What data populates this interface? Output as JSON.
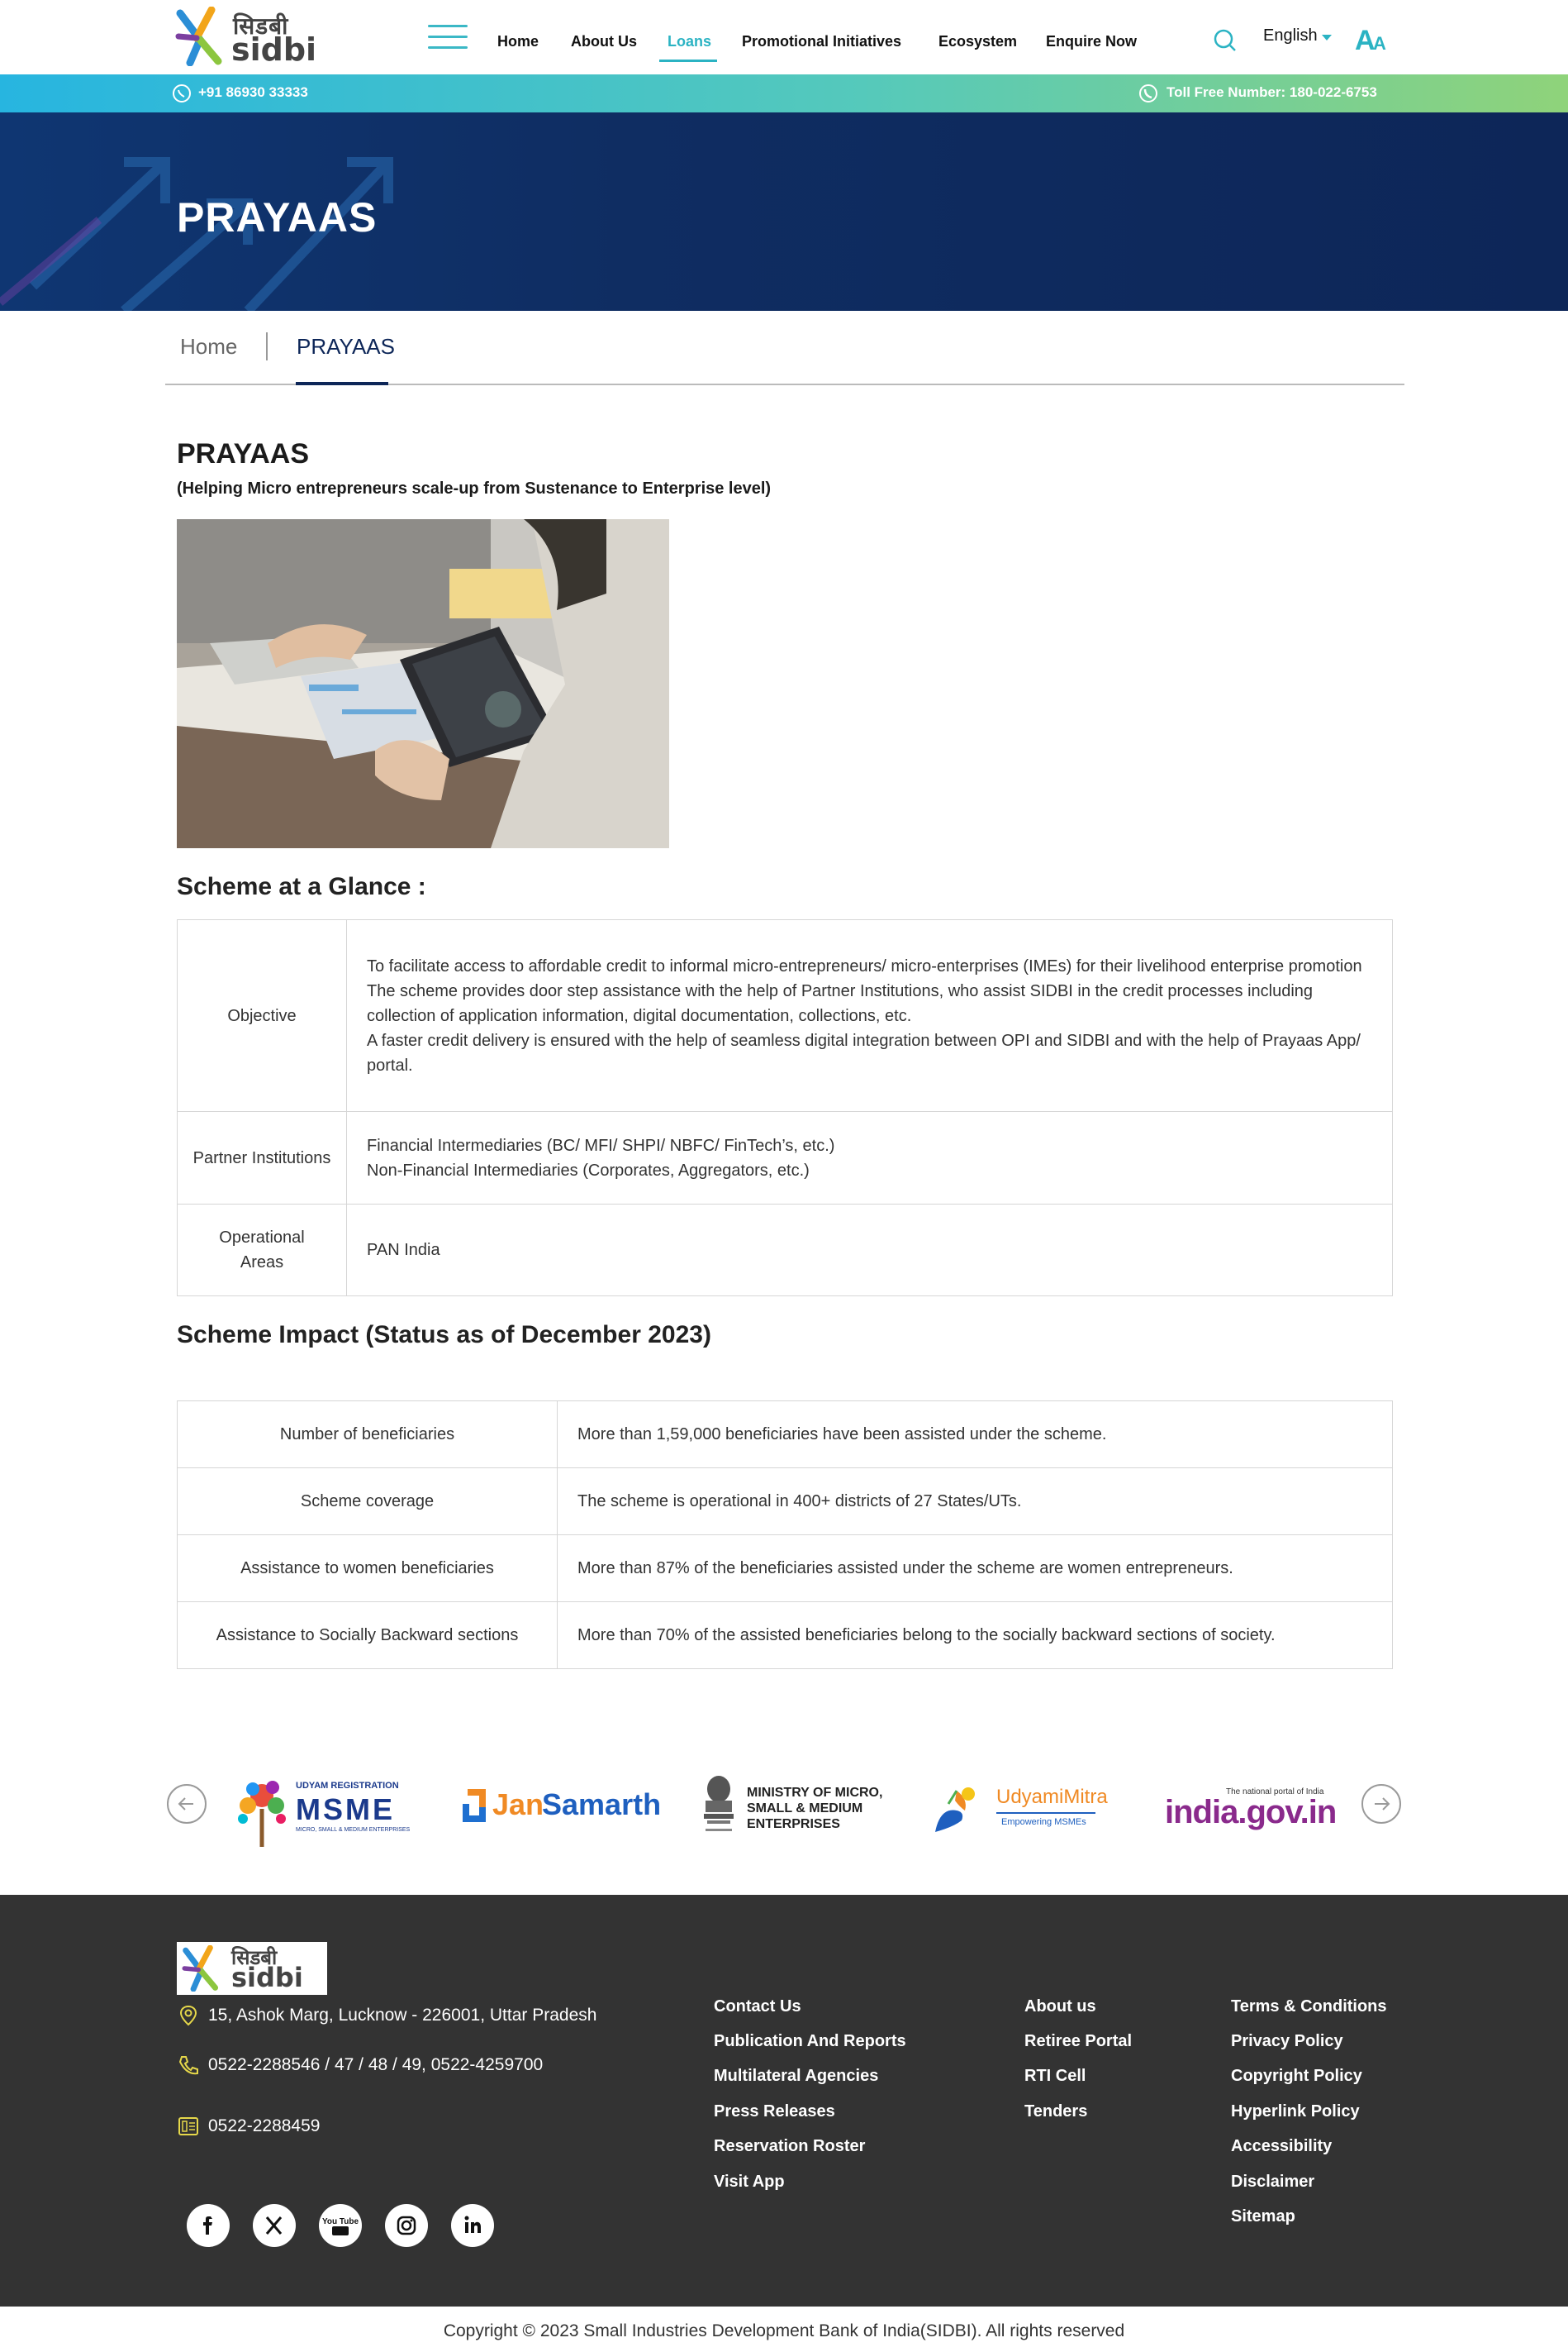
{
  "header": {
    "logo_hindi": "सिडबी",
    "logo_english": "sidbi",
    "nav": [
      "Home",
      "About Us",
      "Loans",
      "Promotional Initiatives",
      "Ecosystem",
      "Enquire Now"
    ],
    "active_nav": "Loans",
    "language": "English",
    "accent_color": "#2bb3c3"
  },
  "strip": {
    "phone": "+91 86930 33333",
    "toll_free": "Toll Free Number: 180-022-6753"
  },
  "banner": {
    "title": "PRAYAAS"
  },
  "breadcrumb": [
    "Home",
    "PRAYAAS"
  ],
  "page": {
    "title": "PRAYAAS",
    "subtitle": "(Helping Micro entrepreneurs scale-up from Sustenance to Enterprise level)"
  },
  "glance": {
    "heading": "Scheme at a Glance :",
    "rows": [
      {
        "label": "Objective",
        "lines": [
          "To facilitate access to affordable credit to informal micro-entrepreneurs/ micro-enterprises (IMEs) for their livelihood enterprise promotion",
          "The scheme provides door step assistance with the help of Partner Institutions, who assist SIDBI in the credit processes including collection of application information, digital documentation, collections, etc.",
          "A faster credit delivery is ensured with the help of seamless digital integration between OPI and SIDBI and with the help of Prayaas App/ portal."
        ]
      },
      {
        "label": "Partner Institutions",
        "lines": [
          "Financial Intermediaries (BC/ MFI/ SHPI/ NBFC/ FinTech’s, etc.)",
          "Non-Financial Intermediaries (Corporates, Aggregators, etc.)"
        ]
      },
      {
        "label": "Operational Areas",
        "lines": [
          "PAN India"
        ]
      }
    ]
  },
  "impact": {
    "heading": "Scheme Impact (Status as of December 2023)",
    "rows": [
      {
        "label": "Number of beneficiaries",
        "value": "More than 1,59,000 beneficiaries have been assisted under the scheme."
      },
      {
        "label": "Scheme coverage",
        "value": "The scheme is operational in 400+ districts of 27 States/UTs."
      },
      {
        "label": "Assistance to women beneficiaries",
        "value": "More than 87% of the beneficiaries assisted under the scheme are women entrepreneurs."
      },
      {
        "label": "Assistance to Socially Backward sections",
        "value": "More than 70% of the assisted beneficiaries belong to the socially backward sections of society."
      }
    ]
  },
  "partners": {
    "msme_top": "UDYAM REGISTRATION",
    "msme_main": "MSME",
    "msme_small": "MICRO, SMALL & MEDIUM ENTERPRISES",
    "jansamarth_a": "Jan",
    "jansamarth_b": "Samarth",
    "ministry": [
      "MINISTRY OF MICRO,",
      "SMALL & MEDIUM",
      "ENTERPRISES"
    ],
    "udyami": "UdyamiMitra",
    "udyami_tag": "Empowering MSMEs",
    "india_top": "The national portal of India",
    "india_main": "india.gov.in"
  },
  "footer": {
    "logo_hindi": "सिडबी",
    "logo_english": "sidbi",
    "address": "15, Ashok Marg, Lucknow - 226001, Uttar Pradesh",
    "phone": "0522-2288546 / 47 / 48 / 49, 0522-4259700",
    "fax": "0522-2288459",
    "col1": [
      "Contact Us",
      "Publication And Reports",
      "Multilateral Agencies",
      "Press Releases",
      "Reservation Roster",
      "Visit App"
    ],
    "col2": [
      "About us",
      "Retiree Portal",
      "RTI Cell",
      "Tenders"
    ],
    "col3": [
      "Terms & Conditions",
      "Privacy Policy",
      "Copyright Policy",
      "Hyperlink Policy",
      "Accessibility",
      "Disclaimer",
      "Sitemap"
    ],
    "social": [
      "facebook-icon",
      "x-icon",
      "youtube-icon",
      "instagram-icon",
      "linkedin-icon"
    ],
    "social_youtube_label": "You Tube",
    "icon_color": "#e6d84a"
  },
  "copyright": "Copyright © 2023 Small Industries Development Bank of India(SIDBI). All rights reserved"
}
